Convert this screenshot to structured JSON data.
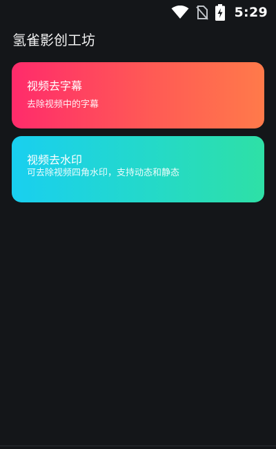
{
  "status_bar": {
    "time": "5:29",
    "icons": [
      "wifi-icon",
      "no-sim-icon",
      "battery-charging-icon"
    ]
  },
  "app": {
    "title": "氢雀影创工坊"
  },
  "cards": [
    {
      "title": "视频去字幕",
      "description": "去除视频中的字幕",
      "gradient": [
        "#ff2b6b",
        "#ff7a4a"
      ]
    },
    {
      "title": "视频去水印",
      "description": "可去除视频四角水印，支持动态和静态",
      "gradient": [
        "#19cff0",
        "#2ee0a6"
      ]
    }
  ],
  "colors": {
    "background": "#141619",
    "text": "#ffffff"
  }
}
